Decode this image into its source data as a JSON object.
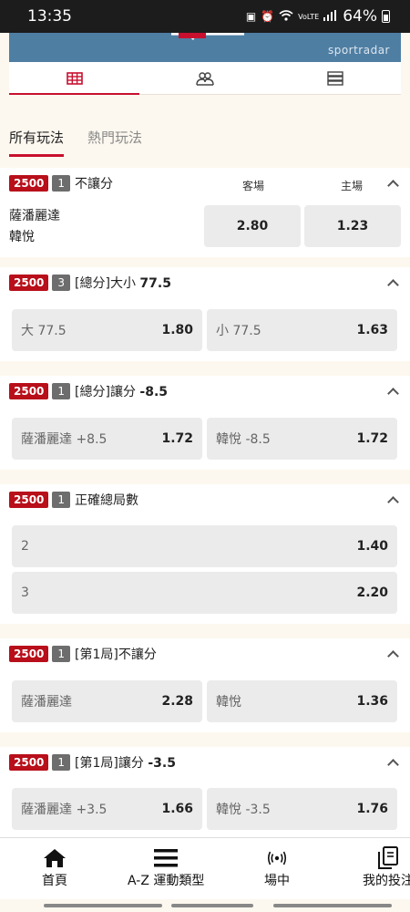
{
  "status_bar": {
    "time": "13:35",
    "battery": "64%",
    "network": "VoLTE"
  },
  "banner": {
    "brand": "sportradar"
  },
  "view_tabs": [
    {
      "icon": "grid-icon",
      "active": true
    },
    {
      "icon": "users-icon",
      "active": false
    },
    {
      "icon": "list-icon",
      "active": false
    }
  ],
  "filters": {
    "all": "所有玩法",
    "popular": "熱門玩法"
  },
  "columns": {
    "away": "客場",
    "home": "主場"
  },
  "markets": [
    {
      "id": "2500",
      "count": "1",
      "name": "不讓分",
      "name_bold": "",
      "teams": [
        "薩潘麗達",
        "韓悅"
      ],
      "odds": [
        "2.80",
        "1.23"
      ]
    },
    {
      "id": "2500",
      "count": "3",
      "name": "[總分]大小 ",
      "name_bold": "77.5",
      "options": [
        {
          "label": "大 77.5",
          "odd": "1.80"
        },
        {
          "label": "小 77.5",
          "odd": "1.63"
        }
      ]
    },
    {
      "id": "2500",
      "count": "1",
      "name": "[總分]讓分 ",
      "name_bold": "-8.5",
      "options": [
        {
          "label": "薩潘麗達 +8.5",
          "odd": "1.72"
        },
        {
          "label": "韓悅 -8.5",
          "odd": "1.72"
        }
      ]
    },
    {
      "id": "2500",
      "count": "1",
      "name": "正確總局數",
      "name_bold": "",
      "options": [
        {
          "label": "2",
          "odd": "1.40"
        },
        {
          "label": "3",
          "odd": "2.20"
        }
      ]
    },
    {
      "id": "2500",
      "count": "1",
      "name": "[第1局]不讓分",
      "name_bold": "",
      "options": [
        {
          "label": "薩潘麗達",
          "odd": "2.28"
        },
        {
          "label": "韓悅",
          "odd": "1.36"
        }
      ]
    },
    {
      "id": "2500",
      "count": "1",
      "name": "[第1局]讓分 ",
      "name_bold": "-3.5",
      "options": [
        {
          "label": "薩潘麗達 +3.5",
          "odd": "1.66"
        },
        {
          "label": "韓悅 -3.5",
          "odd": "1.76"
        }
      ]
    }
  ],
  "bottom_nav": [
    {
      "label": "首頁",
      "icon": "home-icon"
    },
    {
      "label": "A-Z 運動類型",
      "icon": "menu-icon"
    },
    {
      "label": "場中",
      "icon": "live-icon"
    },
    {
      "label": "我的投注",
      "icon": "bets-icon"
    }
  ],
  "colors": {
    "accent": "#c8102e",
    "badge": "#b80f1a",
    "count_badge": "#6d6d6d",
    "odds_button": "#ebebeb"
  }
}
